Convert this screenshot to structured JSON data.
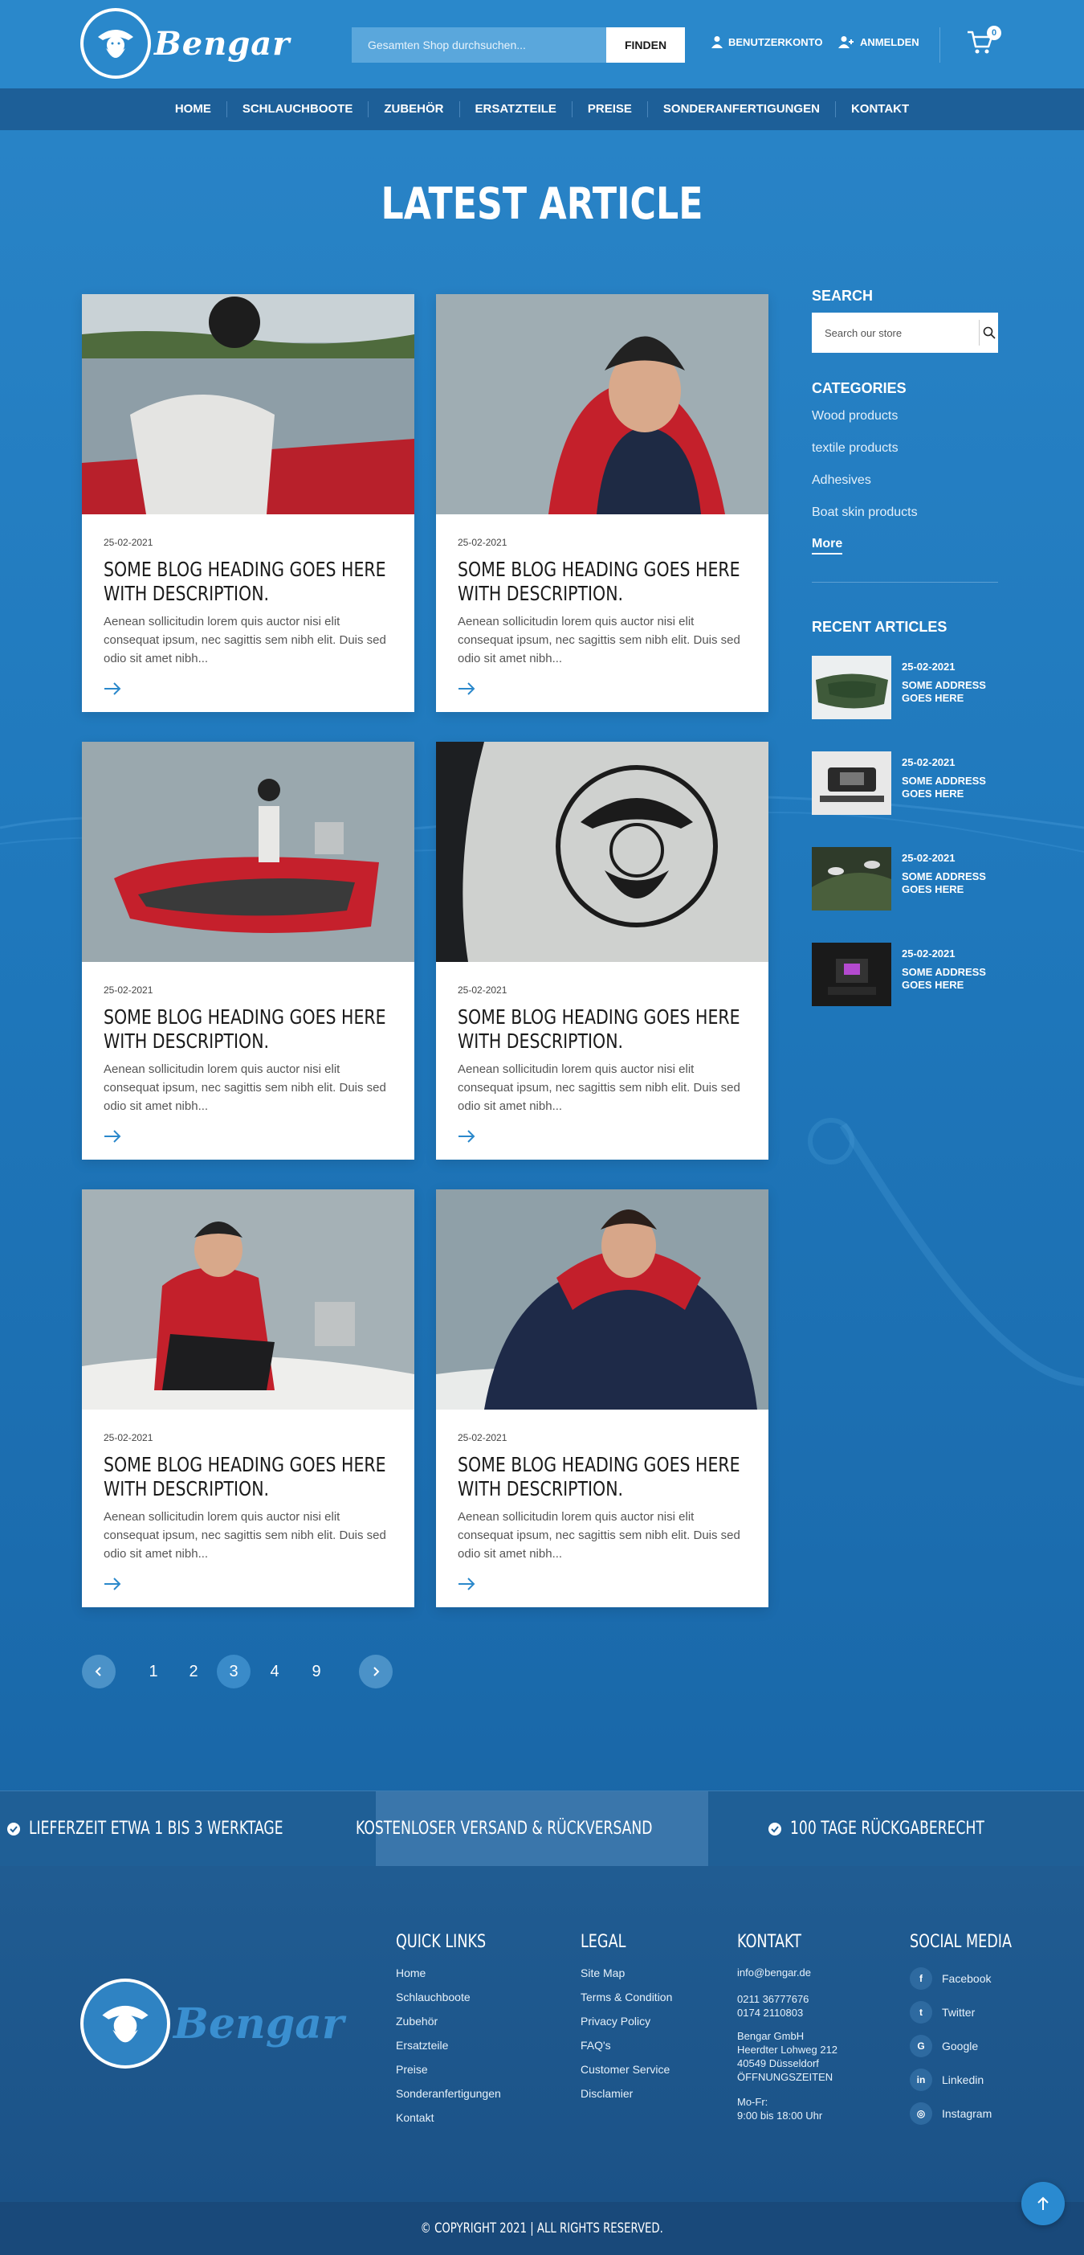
{
  "header": {
    "logo_text": "Bengar",
    "search_placeholder": "Gesamten Shop durchsuchen...",
    "search_button": "FINDEN",
    "account_label": "BENUTZERKONTO",
    "login_label": "ANMELDEN",
    "cart_count": "0"
  },
  "nav": [
    "HOME",
    "SCHLAUCHBOOTE",
    "ZUBEHÖR",
    "ERSATZTEILE",
    "PREISE",
    "SONDERANFERTIGUNGEN",
    "KONTAKT"
  ],
  "page_title": "LATEST ARTICLE",
  "cards": [
    {
      "date": "25-02-2021",
      "heading": "Some blog heading goes here with description.",
      "excerpt": "Aenean sollicitudin lorem quis  auctor nisi elit consequat ipsum, nec sagittis sem nibh elit. Duis sed odio sit amet nibh..."
    },
    {
      "date": "25-02-2021",
      "heading": "Some blog heading goes here with description.",
      "excerpt": "Aenean sollicitudin lorem quis  auctor nisi elit consequat ipsum, nec sagittis sem nibh elit. Duis sed odio sit amet nibh..."
    },
    {
      "date": "25-02-2021",
      "heading": "Some blog heading goes here with description.",
      "excerpt": "Aenean sollicitudin lorem quis  auctor nisi elit consequat ipsum, nec sagittis sem nibh elit. Duis sed odio sit amet nibh..."
    },
    {
      "date": "25-02-2021",
      "heading": "Some blog heading goes here with description.",
      "excerpt": "Aenean sollicitudin lorem quis  auctor nisi elit consequat ipsum, nec sagittis sem nibh elit. Duis sed odio sit amet nibh..."
    },
    {
      "date": "25-02-2021",
      "heading": "Some blog heading goes here with description.",
      "excerpt": "Aenean sollicitudin lorem quis  auctor nisi elit consequat ipsum, nec sagittis sem nibh elit. Duis sed odio sit amet nibh..."
    },
    {
      "date": "25-02-2021",
      "heading": "Some blog heading goes here with description.",
      "excerpt": "Aenean sollicitudin lorem quis  auctor nisi elit consequat ipsum, nec sagittis sem nibh elit. Duis sed odio sit amet nibh..."
    }
  ],
  "sidebar": {
    "search_title": "SEARCH",
    "search_placeholder": "Search our store",
    "categories_title": "CATEGORIES",
    "categories": [
      "Wood products",
      "textile products",
      "Adhesives",
      "Boat skin products"
    ],
    "more_label": "More",
    "recent_title": "RECENT ARTICLES",
    "recent": [
      {
        "date": "25-02-2021",
        "title": "SOME ADDRESS GOES HERE"
      },
      {
        "date": "25-02-2021",
        "title": "SOME ADDRESS GOES HERE"
      },
      {
        "date": "25-02-2021",
        "title": "SOME ADDRESS GOES HERE"
      },
      {
        "date": "25-02-2021",
        "title": "SOME ADDRESS GOES HERE"
      }
    ]
  },
  "pagination": {
    "pages": [
      "1",
      "2",
      "3",
      "4",
      "9"
    ],
    "current": "3"
  },
  "features": [
    "LIEFERZEIT ETWA 1 BIS 3 WERKTAGE",
    "KOSTENLOSER VERSAND & RÜCKVERSAND",
    "100 TAGE RÜCKGABERECHT"
  ],
  "footer": {
    "logo_text": "Bengar",
    "quick_links_title": "QUICK LINKS",
    "quick_links": [
      "Home",
      "Schlauchboote",
      "Zubehör",
      "Ersatzteile",
      "Preise",
      "Sonderanfertigungen",
      "Kontakt"
    ],
    "legal_title": "LEGAL",
    "legal": [
      "Site Map",
      "Terms & Condition",
      "Privacy Policy",
      "FAQ's",
      "Customer Service",
      "Disclamier"
    ],
    "contact_title": "KONTAKT",
    "contact_email": "info@bengar.de",
    "contact_phone1": "0211 36777676",
    "contact_phone2": "0174 2110803",
    "contact_company": "Bengar GmbH",
    "contact_street": "Heerdter Lohweg 212",
    "contact_city": "40549 Düsseldorf",
    "contact_hours_title": "ÖFFNUNGSZEITEN",
    "contact_days": "Mo-Fr:",
    "contact_hours": "9:00 bis 18:00 Uhr",
    "social_title": "SOCIAL MEDIA",
    "social": [
      {
        "icon": "facebook-icon",
        "glyph": "f",
        "label": "Facebook"
      },
      {
        "icon": "twitter-icon",
        "glyph": "t",
        "label": "Twitter"
      },
      {
        "icon": "google-icon",
        "glyph": "G",
        "label": "Google"
      },
      {
        "icon": "linkedin-icon",
        "glyph": "in",
        "label": "Linkedin"
      },
      {
        "icon": "instagram-icon",
        "glyph": "◎",
        "label": "Instagram"
      }
    ]
  },
  "copyright": "© COPYRIGHT 2021 | ALL RIGHTS RESERVED."
}
